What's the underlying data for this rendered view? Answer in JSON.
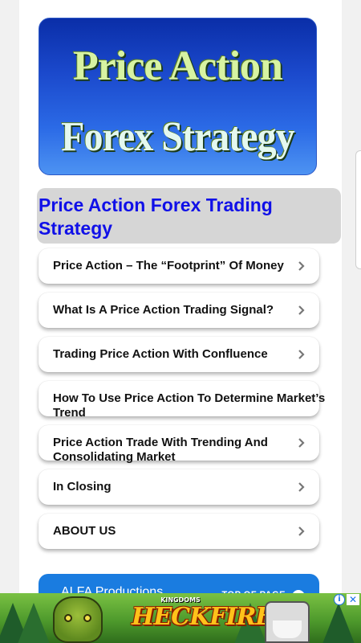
{
  "hero": {
    "line1": "Price Action",
    "line2": "Forex Strategy"
  },
  "page_title": "Price Action Forex Trading Strategy",
  "menu": [
    {
      "label": "Price Action – The “Footprint” Of Money"
    },
    {
      "label": "What Is A Price Action Trading Signal?"
    },
    {
      "label": "Trading Price Action With Confluence"
    },
    {
      "label": "How To Use Price Action To Determine Market’s Trend"
    },
    {
      "label": "Price Action Trade With Trending And Consolidating Market"
    },
    {
      "label": "In Closing"
    },
    {
      "label": "ABOUT US"
    }
  ],
  "footer": {
    "brand": "ALFA Productions",
    "top_link": "TOP OF PAGE"
  },
  "ad": {
    "kingdoms": "KINGDOMS",
    "title": "HECKFIRE",
    "info_icon": "i",
    "close_icon": "✕"
  },
  "colors": {
    "title_blue": "#1010e8",
    "footer_blue": "#1a7ce0",
    "heading_bg": "#d6d6d6"
  }
}
